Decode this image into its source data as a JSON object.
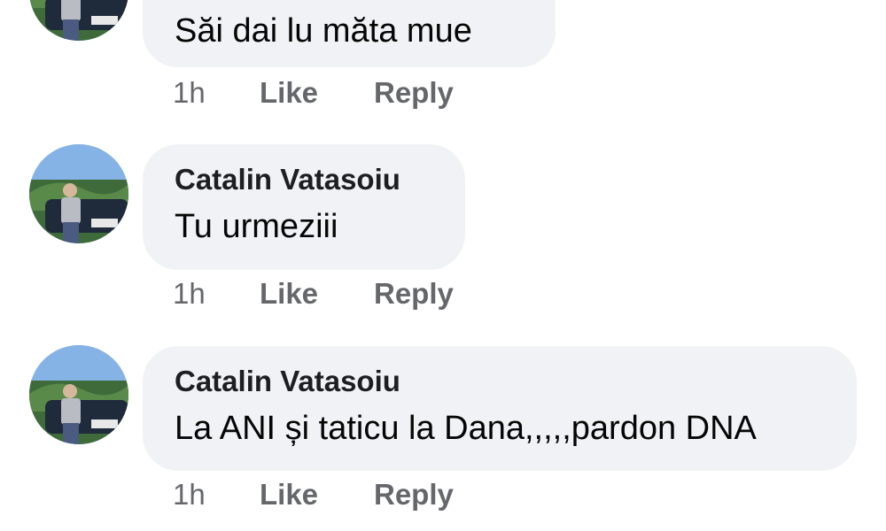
{
  "comments": [
    {
      "author": "",
      "text": "Săi dai lu măta mue",
      "time": "1h",
      "like_label": "Like",
      "reply_label": "Reply"
    },
    {
      "author": "Catalin Vatasoiu",
      "text": "Tu urmeziii",
      "time": "1h",
      "like_label": "Like",
      "reply_label": "Reply"
    },
    {
      "author": "Catalin Vatasoiu",
      "text": "La ANI și taticu la Dana,,,,,pardon DNA",
      "time": "1h",
      "like_label": "Like",
      "reply_label": "Reply"
    }
  ],
  "colors": {
    "bubble": "#f0f2f5",
    "meta": "#65676b",
    "author": "#1c1e21"
  }
}
